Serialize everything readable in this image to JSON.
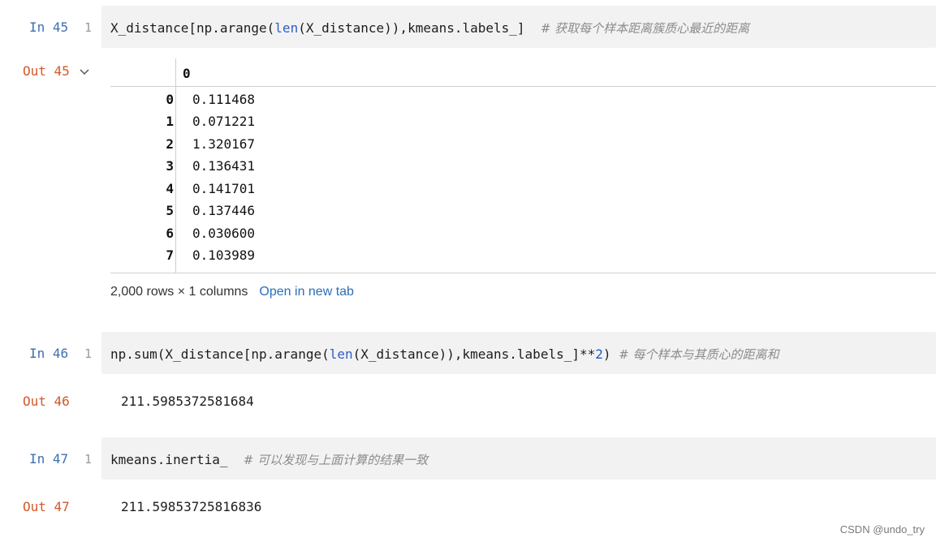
{
  "cells": [
    {
      "in_label": "In 45",
      "line": "1",
      "code": {
        "p1": "X_distance[np.arange(",
        "fn": "len",
        "p2": "(X_distance)),kmeans.labels_]  ",
        "comment": "# 获取每个样本距离簇质心最近的距离"
      },
      "out_label": "Out 45"
    },
    {
      "in_label": "In 46",
      "line": "1",
      "code": {
        "p1": "np.sum(X_distance[np.arange(",
        "fn": "len",
        "p2": "(X_distance)),kmeans.labels_]**",
        "num": "2",
        "p3": ") ",
        "comment": "# 每个样本与其质心的距离和"
      },
      "out_label": "Out 46",
      "output": "211.5985372581684"
    },
    {
      "in_label": "In 47",
      "line": "1",
      "code": {
        "p1": "kmeans.inertia_  ",
        "comment": "# 可以发现与上面计算的结果一致"
      },
      "out_label": "Out 47",
      "output": "211.59853725816836"
    }
  ],
  "dataframe": {
    "column": "0",
    "index": [
      "0",
      "1",
      "2",
      "3",
      "4",
      "5",
      "6",
      "7"
    ],
    "values": [
      "0.111468",
      "0.071221",
      "1.320167",
      "0.136431",
      "0.141701",
      "0.137446",
      "0.030600",
      "0.103989"
    ],
    "shape_text": "2,000 rows × 1 columns",
    "open_link": "Open in new tab"
  },
  "icons": {
    "collapse": "chevron-down-icon"
  },
  "colors": {
    "in_prompt": "#3f6fb0",
    "out_prompt": "#d2592a",
    "cell_bg": "#f2f2f2",
    "link": "#2a6fb8"
  },
  "watermark": "CSDN @undo_try"
}
